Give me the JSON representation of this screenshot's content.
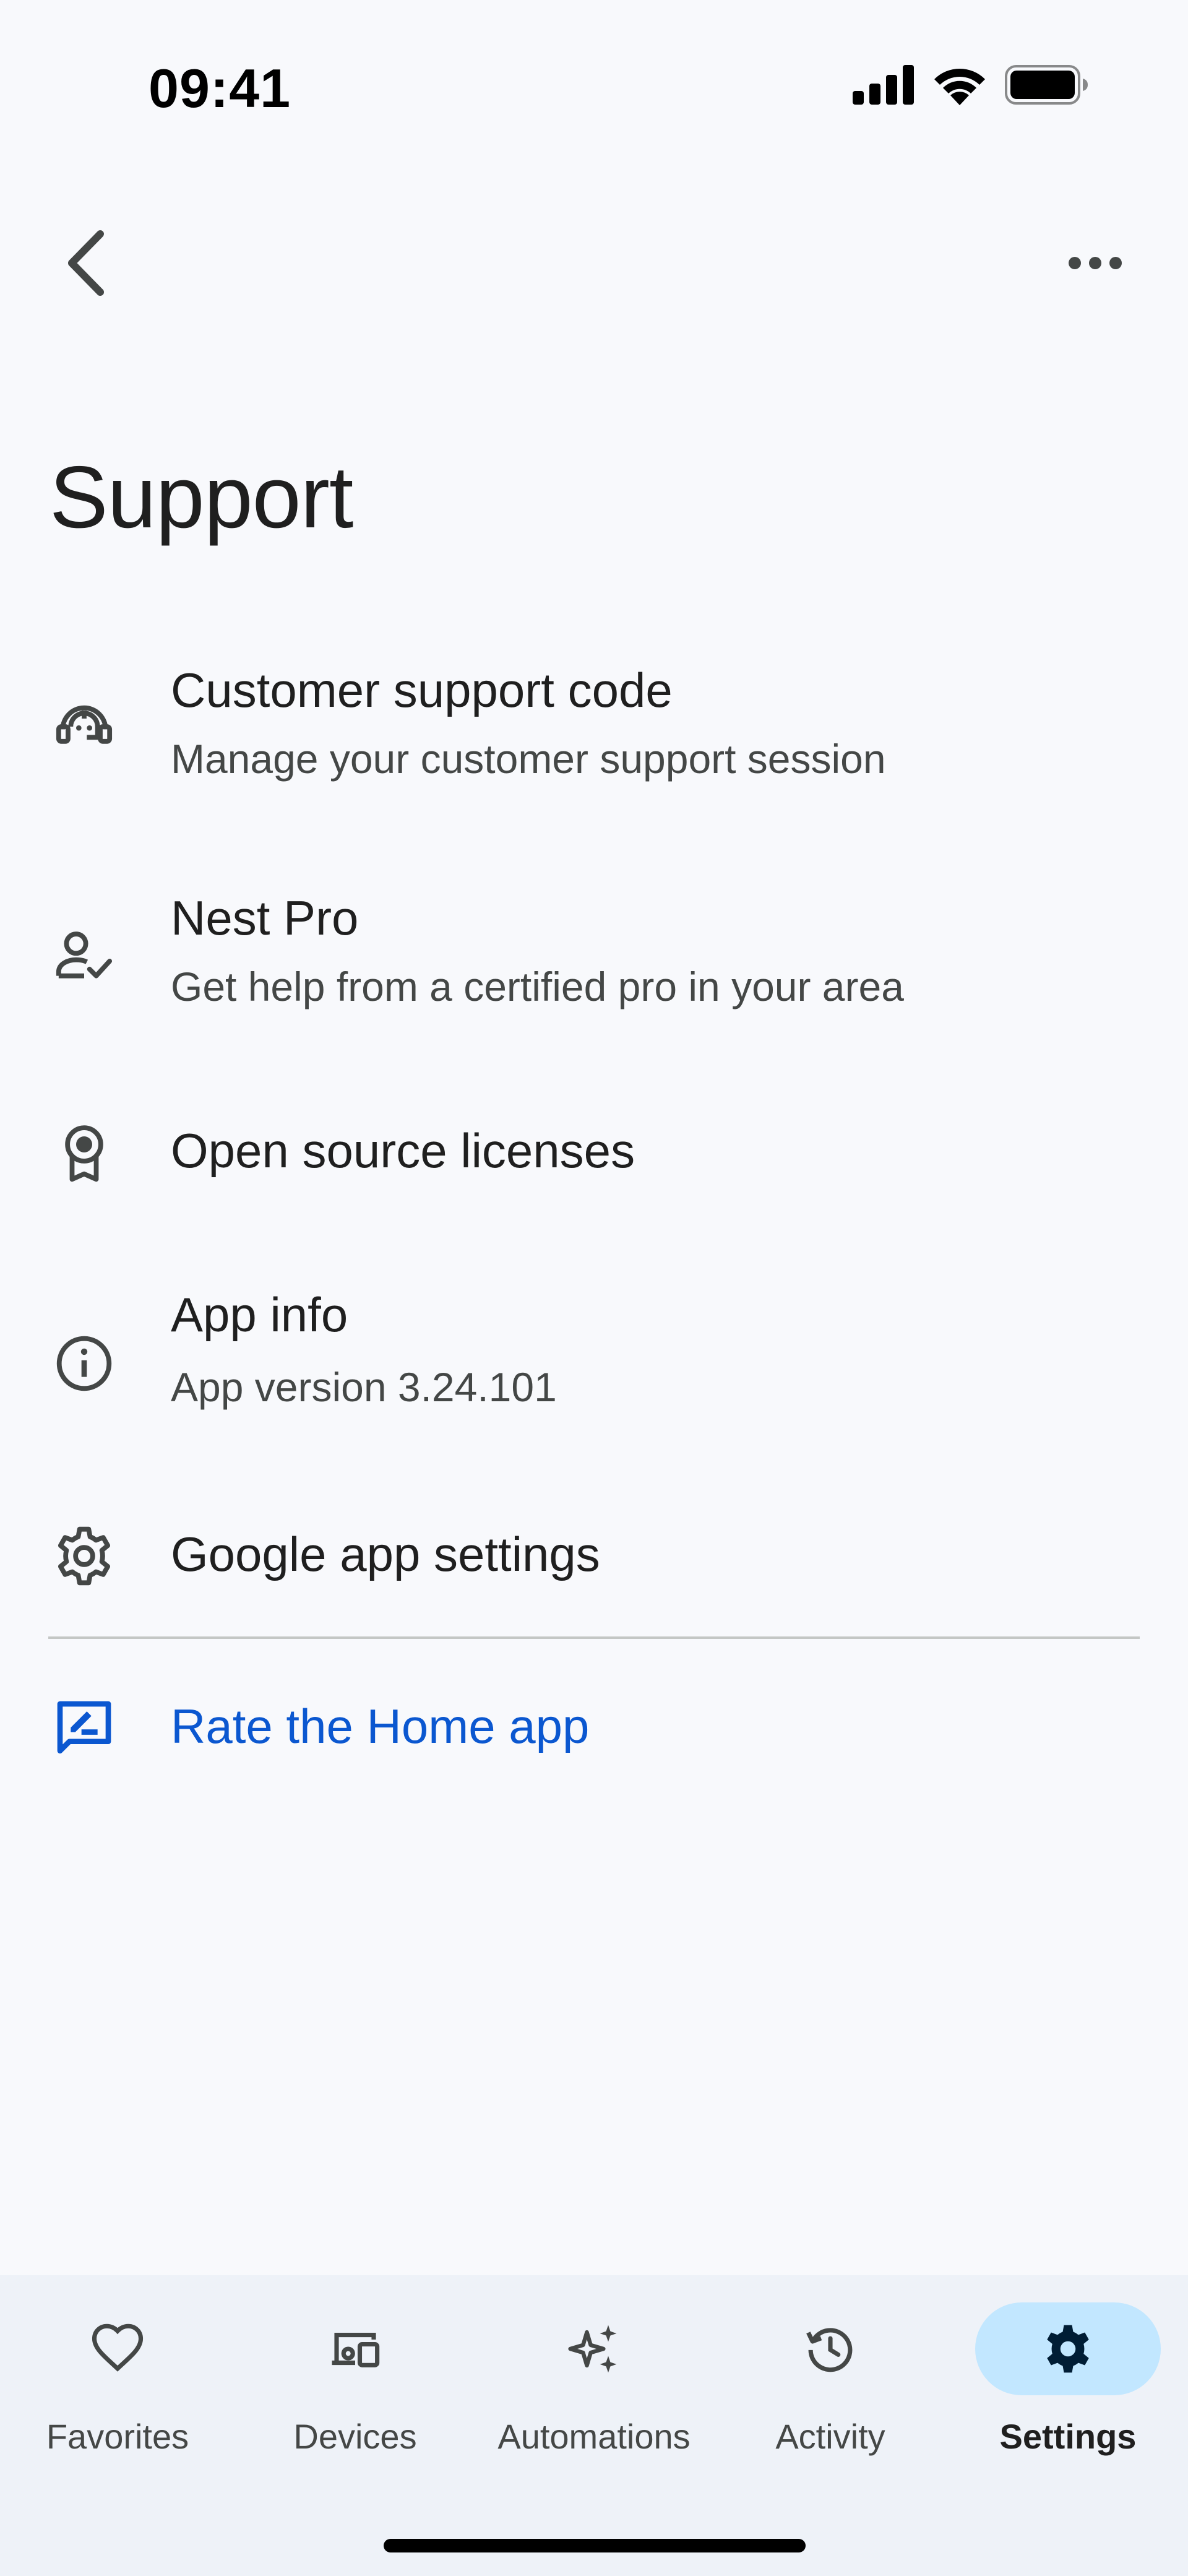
{
  "status_bar": {
    "time": "09:41"
  },
  "header": {
    "back_icon": "chevron-left-icon",
    "more_icon": "more-horizontal-icon"
  },
  "page": {
    "title": "Support"
  },
  "items": [
    {
      "icon": "support-agent-icon",
      "title": "Customer support code",
      "subtitle": "Manage your customer support session"
    },
    {
      "icon": "verified-user-icon",
      "title": "Nest Pro",
      "subtitle": "Get help from a certified pro in your area"
    },
    {
      "icon": "license-badge-icon",
      "title": "Open source licenses"
    },
    {
      "icon": "info-icon",
      "title": "App info",
      "subtitle": "App version 3.24.101"
    },
    {
      "icon": "gear-icon",
      "title": "Google app settings"
    }
  ],
  "rate": {
    "icon": "feedback-icon",
    "label": "Rate the Home app",
    "color": "#0b57d0"
  },
  "nav": {
    "items": [
      {
        "icon": "heart-icon",
        "label": "Favorites"
      },
      {
        "icon": "devices-icon",
        "label": "Devices"
      },
      {
        "icon": "sparkle-icon",
        "label": "Automations"
      },
      {
        "icon": "history-icon",
        "label": "Activity"
      },
      {
        "icon": "gear-icon",
        "label": "Settings",
        "active": true
      }
    ],
    "active_color": "#c2e7ff"
  }
}
